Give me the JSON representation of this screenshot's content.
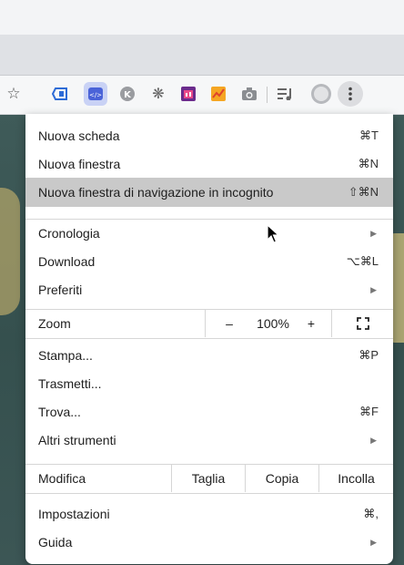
{
  "toolbar_icons": [
    "star-icon",
    "extension-icon-1",
    "extension-code-icon",
    "extension-k-icon",
    "extension-gear-icon",
    "extension-calendar-icon",
    "extension-chart-icon",
    "extension-camera-icon",
    "reading-list-icon",
    "profile-avatar-icon",
    "menu-dots-icon"
  ],
  "star_glyph": "☆",
  "menu": {
    "new_tab": {
      "label": "Nuova scheda",
      "shortcut": "⌘T"
    },
    "new_window": {
      "label": "Nuova finestra",
      "shortcut": "⌘N"
    },
    "new_incognito": {
      "label": "Nuova finestra di navigazione in incognito",
      "shortcut": "⇧⌘N"
    },
    "history": {
      "label": "Cronologia",
      "arrow": "▶"
    },
    "downloads": {
      "label": "Download",
      "shortcut": "⌥⌘L"
    },
    "bookmarks": {
      "label": "Preferiti",
      "arrow": "▶"
    },
    "zoom": {
      "label": "Zoom",
      "minus": "–",
      "value": "100%",
      "plus": "+"
    },
    "print": {
      "label": "Stampa...",
      "shortcut": "⌘P"
    },
    "cast": {
      "label": "Trasmetti..."
    },
    "find": {
      "label": "Trova...",
      "shortcut": "⌘F"
    },
    "more_tools": {
      "label": "Altri strumenti",
      "arrow": "▶"
    },
    "edit": {
      "label": "Modifica",
      "cut": "Taglia",
      "copy": "Copia",
      "paste": "Incolla"
    },
    "settings": {
      "label": "Impostazioni",
      "shortcut": "⌘,"
    },
    "help": {
      "label": "Guida",
      "arrow": "▶"
    }
  },
  "colors": {
    "highlight": "#c9c9c9",
    "menu_bg": "#ffffff",
    "separator": "#d6d6d6"
  }
}
